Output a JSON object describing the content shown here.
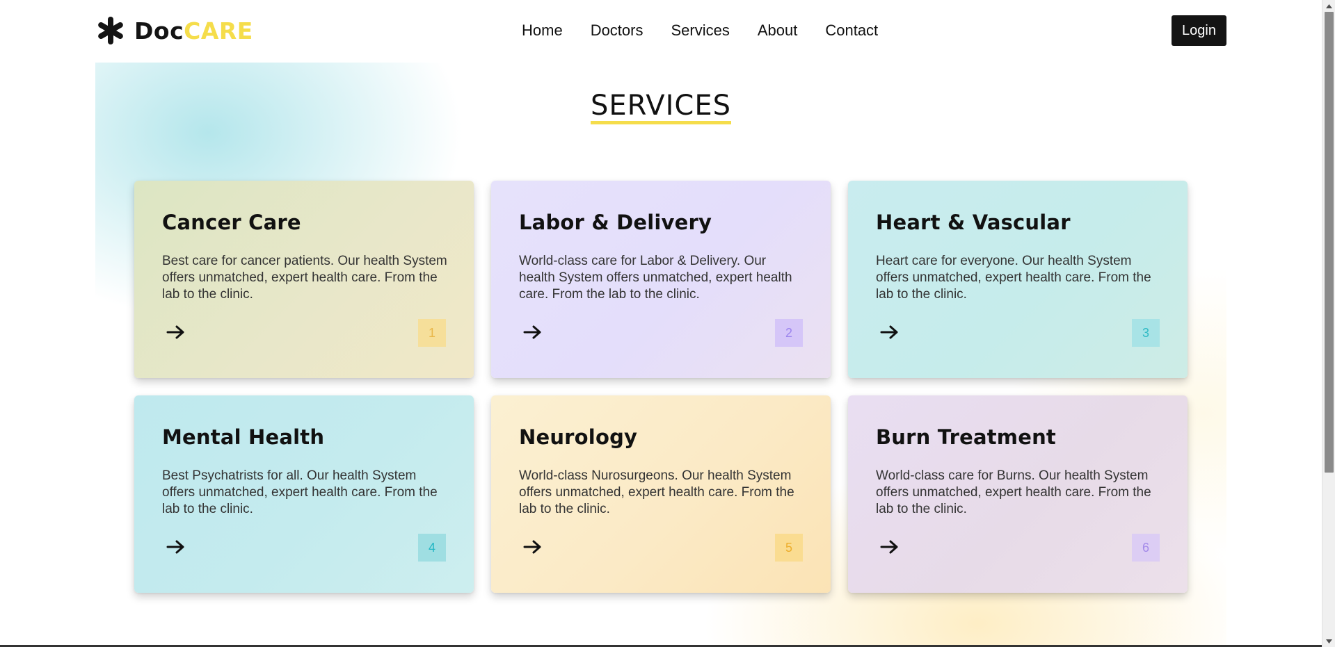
{
  "brand": {
    "name_part1": "Doc",
    "name_part2": "CARE",
    "icon": "asterisk-logo-icon",
    "colors": {
      "dark": "#141414",
      "accent": "#f5dd4b"
    }
  },
  "nav": {
    "items": [
      {
        "label": "Home"
      },
      {
        "label": "Doctors"
      },
      {
        "label": "Services"
      },
      {
        "label": "About"
      },
      {
        "label": "Contact"
      }
    ],
    "login_label": "Login"
  },
  "services": {
    "title": "SERVICES",
    "cards": [
      {
        "title": "Cancer Care",
        "description": "Best care for cancer patients. Our health System offers unmatched, expert health care. From the lab to the clinic.",
        "number": "1",
        "arrow_icon": "arrow-right-icon"
      },
      {
        "title": "Labor & Delivery",
        "description": "World-class care for Labor & Delivery. Our health System offers unmatched, expert health care. From the lab to the clinic.",
        "number": "2",
        "arrow_icon": "arrow-right-icon"
      },
      {
        "title": "Heart & Vascular",
        "description": "Heart care for everyone. Our health System offers unmatched, expert health care. From the lab to the clinic.",
        "number": "3",
        "arrow_icon": "arrow-right-icon"
      },
      {
        "title": "Mental Health",
        "description": "Best Psychatrists for all. Our health System offers unmatched, expert health care. From the lab to the clinic.",
        "number": "4",
        "arrow_icon": "arrow-right-icon"
      },
      {
        "title": "Neurology",
        "description": "World-class Nurosurgeons. Our health System offers unmatched, expert health care. From the lab to the clinic.",
        "number": "5",
        "arrow_icon": "arrow-right-icon"
      },
      {
        "title": "Burn Treatment",
        "description": "World-class care for Burns. Our health System offers unmatched, expert health care. From the lab to the clinic.",
        "number": "6",
        "arrow_icon": "arrow-right-icon"
      }
    ]
  }
}
